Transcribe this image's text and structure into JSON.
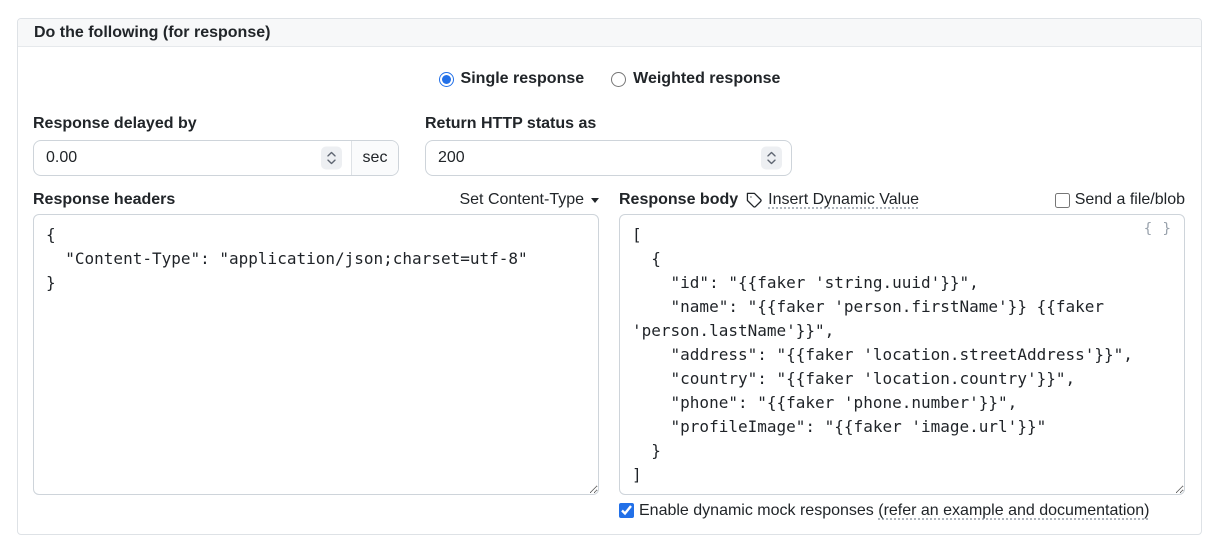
{
  "panel": {
    "title": "Do the following (for response)"
  },
  "response_type": {
    "options": [
      {
        "label": "Single response",
        "selected": true
      },
      {
        "label": "Weighted response",
        "selected": false
      }
    ]
  },
  "delay": {
    "label": "Response delayed by",
    "value": "0.00",
    "unit": "sec"
  },
  "status": {
    "label": "Return HTTP status as",
    "value": "200"
  },
  "headers": {
    "label": "Response headers",
    "content_type_dropdown": "Set Content-Type",
    "value": "{\n  \"Content-Type\": \"application/json;charset=utf-8\"\n}"
  },
  "body": {
    "label": "Response body",
    "insert_dynamic_value": "Insert Dynamic Value",
    "send_file": {
      "label": "Send a file/blob",
      "checked": false
    },
    "beautify_icon": "{ }",
    "value": "[\n  {\n    \"id\": \"{{faker 'string.uuid'}}\",\n    \"name\": \"{{faker 'person.firstName'}} {{faker 'person.lastName'}}\",\n    \"address\": \"{{faker 'location.streetAddress'}}\",\n    \"country\": \"{{faker 'location.country'}}\",\n    \"phone\": \"{{faker 'phone.number'}}\",\n    \"profileImage\": \"{{faker 'image.url'}}\"\n  }\n]"
  },
  "dynamic_mock": {
    "label": "Enable dynamic mock responses",
    "link": "(refer an example and documentation)",
    "checked": true
  },
  "colors": {
    "accent": "#2270e8",
    "panel_border": "#dee2e6",
    "header_bg": "#f7f8f9",
    "input_border": "#ced4da"
  }
}
